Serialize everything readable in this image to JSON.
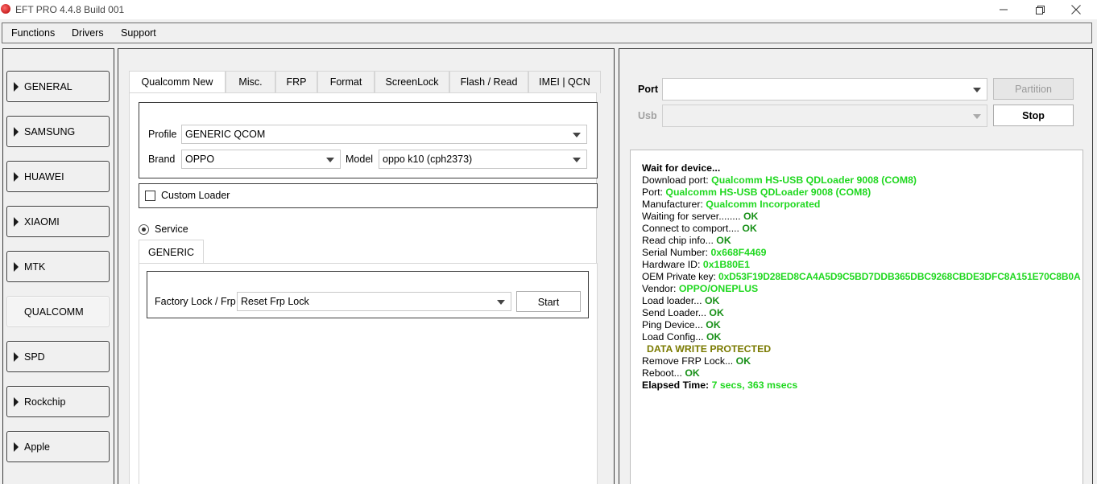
{
  "window": {
    "title": "EFT PRO 4.4.8 Build 001",
    "icon": "eft-logo-icon",
    "controls": {
      "minimize": "—",
      "maximize": "❐",
      "close": "✕"
    }
  },
  "menu": {
    "items": [
      "Functions",
      "Drivers",
      "Support"
    ]
  },
  "sidebar": {
    "items": [
      {
        "label": "GENERAL",
        "active": false
      },
      {
        "label": "SAMSUNG",
        "active": false
      },
      {
        "label": "HUAWEI",
        "active": false
      },
      {
        "label": "XIAOMI",
        "active": false
      },
      {
        "label": "MTK",
        "active": false
      },
      {
        "label": "QUALCOMM",
        "active": true
      },
      {
        "label": "SPD",
        "active": false
      },
      {
        "label": "Rockchip",
        "active": false
      },
      {
        "label": "Apple",
        "active": false
      }
    ]
  },
  "main": {
    "tabs": [
      "Qualcomm New",
      "Misc.",
      "FRP",
      "Format",
      "ScreenLock",
      "Flash / Read",
      "IMEI | QCN"
    ],
    "active_tab": "Qualcomm New",
    "profile_label": "Profile",
    "profile_value": "GENERIC QCOM",
    "brand_label": "Brand",
    "brand_value": "OPPO",
    "model_label": "Model",
    "model_value": "oppo k10 (cph2373)",
    "custom_loader_label": "Custom Loader",
    "custom_loader_checked": false,
    "service_label": "Service",
    "service_selected": true,
    "subtab": "GENERIC",
    "factory_lock_label": "Factory Lock / Frp",
    "factory_lock_value": "Reset Frp Lock",
    "start_button": "Start"
  },
  "right": {
    "port_label": "Port",
    "port_value": "",
    "usb_label": "Usb",
    "usb_value": "",
    "partition_button": "Partition",
    "stop_button": "Stop"
  },
  "log": {
    "wait": "Wait for device...",
    "download_port_label": "Download port: ",
    "download_port_value": "Qualcomm HS-USB QDLoader 9008 (COM8)",
    "port_label": "Port: ",
    "port_value": "Qualcomm HS-USB QDLoader 9008 (COM8)",
    "manufacturer_label": "Manufacturer: ",
    "manufacturer_value": "Qualcomm Incorporated",
    "waiting_server_label": "Waiting for server........ ",
    "waiting_server_value": "OK",
    "connect_label": "Connect to comport.... ",
    "connect_value": "OK",
    "chip_label": "Read chip info... ",
    "chip_value": "OK",
    "serial_label": "Serial Number: ",
    "serial_value": "0x668F4469",
    "hwid_label": "Hardware ID: ",
    "hwid_value": "0x1B80E1",
    "oem_label": "OEM Private key: ",
    "oem_value": "0xD53F19D28ED8CA4A5D9C5BD7DDB365DBC9268CBDE3DFC8A151E70C8B0A",
    "vendor_label": "Vendor: ",
    "vendor_value": "OPPO/ONEPLUS",
    "load_loader_label": "Load loader... ",
    "load_loader_value": "OK",
    "send_loader_label": "Send Loader... ",
    "send_loader_value": "OK",
    "ping_label": "Ping Device... ",
    "ping_value": "OK",
    "load_config_label": "Load Config... ",
    "load_config_value": "OK",
    "write_protected": "DATA WRITE PROTECTED",
    "remove_frp_label": "Remove FRP Lock... ",
    "remove_frp_value": "OK",
    "reboot_label": "Reboot... ",
    "reboot_value": "OK",
    "elapsed_label": "Elapsed Time: ",
    "elapsed_value": "7 secs, 363 msecs"
  },
  "colors": {
    "ok_green": "#20d820",
    "warning_olive": "#7a7a00"
  }
}
